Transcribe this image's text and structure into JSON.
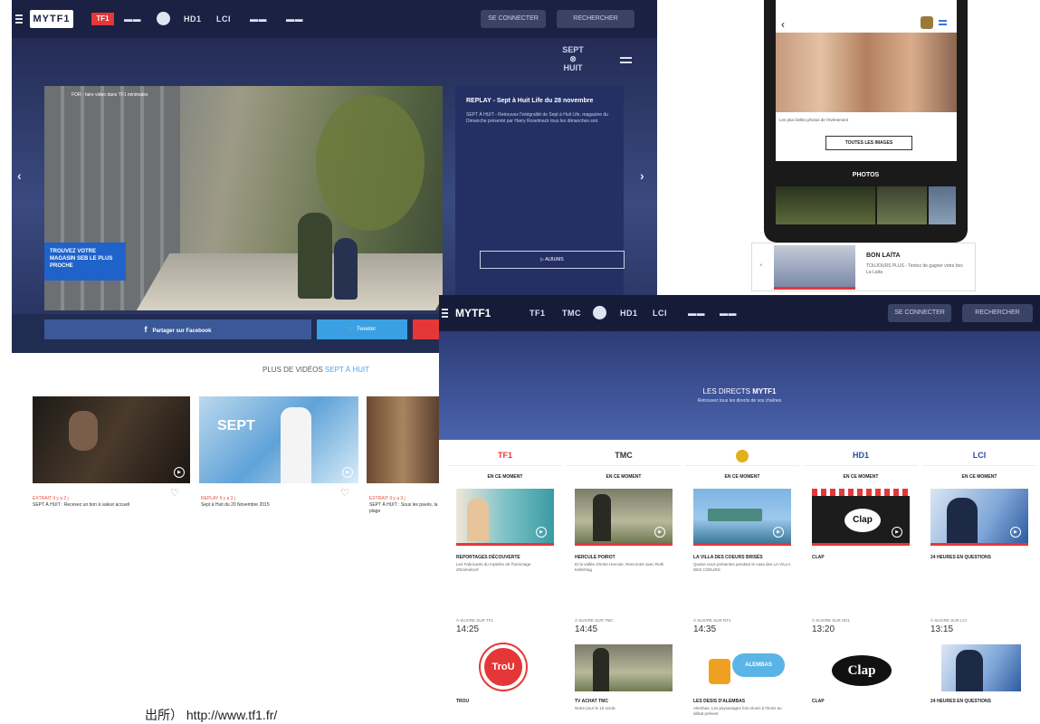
{
  "screen1": {
    "nav": [
      "TF1",
      "",
      "",
      "",
      "",
      "",
      "",
      ""
    ],
    "brand": "MYTF1",
    "login": "SE CONNECTER",
    "search": "RECHERCHER",
    "show_logo": "SEPT\n⊗\nHUIT",
    "video_caption": "FOR - faire video dans TF1 minimales",
    "promo": "TROUVEZ VOTRE MAGASIN SEB LE PLUS PROCHE",
    "info_title": "REPLAY - Sept à Huit Life du 28 novembre",
    "info_text": "SEPT À HUIT - Retrouvez l'intégralité de Sept à Huit Life, magazine du Dimanche présenté par Harry Roselmack tous les dimanches soir.",
    "info_button": "▷ ALBUMS",
    "share_fb": "Partager sur Facebook",
    "share_tw": "Tweeter",
    "more_title": "PLUS DE VIDÉOS",
    "more_title_accent": "SEPT À HUIT",
    "thumbs": [
      {
        "cat": "EXTRAIT",
        "tag": "Il y a 2 j",
        "title": "SEPT À HUIT : Recevez un bon à valeur accueil"
      },
      {
        "cat": "REPLAY",
        "tag": "Il y a 3 j",
        "title": "Sept à Huit du 20 Novembre 2015"
      },
      {
        "cat": "EXTRAIT",
        "tag": "Il y a 3 j",
        "title": "SEPT À HUIT : Sous les pavés, la plage"
      }
    ]
  },
  "phone": {
    "caption": "Les plus belles photos de l'évènement",
    "button": "TOUTES LES IMAGES",
    "photos": "PHOTOS",
    "toast_title": "BON LAÏTA",
    "toast_text": "TOUJOURS PLUS - Tentez de gagner votre box La Laïta"
  },
  "screen2": {
    "brand": "MYTF1",
    "login": "SE CONNECTER",
    "search": "RECHERCHER",
    "band_title_prefix": "LES DIRECTS",
    "band_title_brand": "MYTF1",
    "band_sub": "Retrouvez tous les directs de vos chaînes",
    "channels": [
      {
        "logo": "TF1",
        "color": "#e53737",
        "now": "EN CE MOMENT",
        "title": "REPORTAGES DÉCOUVERTE",
        "desc": "Les Fabricants du mystère de l'hommage d'Enimelcerf",
        "next_lbl": "À SUIVRE SUR TF1",
        "next_time": "14:25",
        "next_title": "TROU",
        "next_desc": ""
      },
      {
        "logo": "TMC",
        "color": "#333333",
        "now": "EN CE MOMENT",
        "title": "HERCULE POIROT",
        "desc": "Et la vallée d'entre Hercule. Rencontre avec Ruth Kellerhag",
        "next_lbl": "À SUIVRE SUR TMC",
        "next_time": "14:45",
        "next_title": "TV ACHAT TMC",
        "next_desc": "Notre pour le 10 octob."
      },
      {
        "logo": "NT1",
        "color": "#e2b018",
        "now": "EN CE MOMENT",
        "title": "LA VILLA DES COEURS BRISÉS",
        "desc": "Quatre nous présentes pendant le casa des LA VILLA DES COEURS",
        "next_lbl": "À SUIVRE SUR NT1",
        "next_time": "14:35",
        "next_title": "LES DESIS D'ALEMBAS",
        "next_desc": "Alembas, Les paysanages fois réunis à l'Emis au débat présent"
      },
      {
        "logo": "HD1",
        "color": "#2a4fa0",
        "now": "EN CE MOMENT",
        "title": "CLAP",
        "desc": "",
        "next_lbl": "À SUIVRE SUR HD1",
        "next_time": "13:20",
        "next_title": "CLAP",
        "next_desc": ""
      },
      {
        "logo": "LCI",
        "color": "#2a4fa0",
        "now": "EN CE MOMENT",
        "title": "24 HEURES EN QUESTIONS",
        "desc": "",
        "next_lbl": "À SUIVRE SUR LCI",
        "next_time": "13:15",
        "next_title": "24 HEURES EN QUESTIONS",
        "next_desc": ""
      }
    ]
  },
  "source_note": "出所） http://www.tf1.fr/"
}
